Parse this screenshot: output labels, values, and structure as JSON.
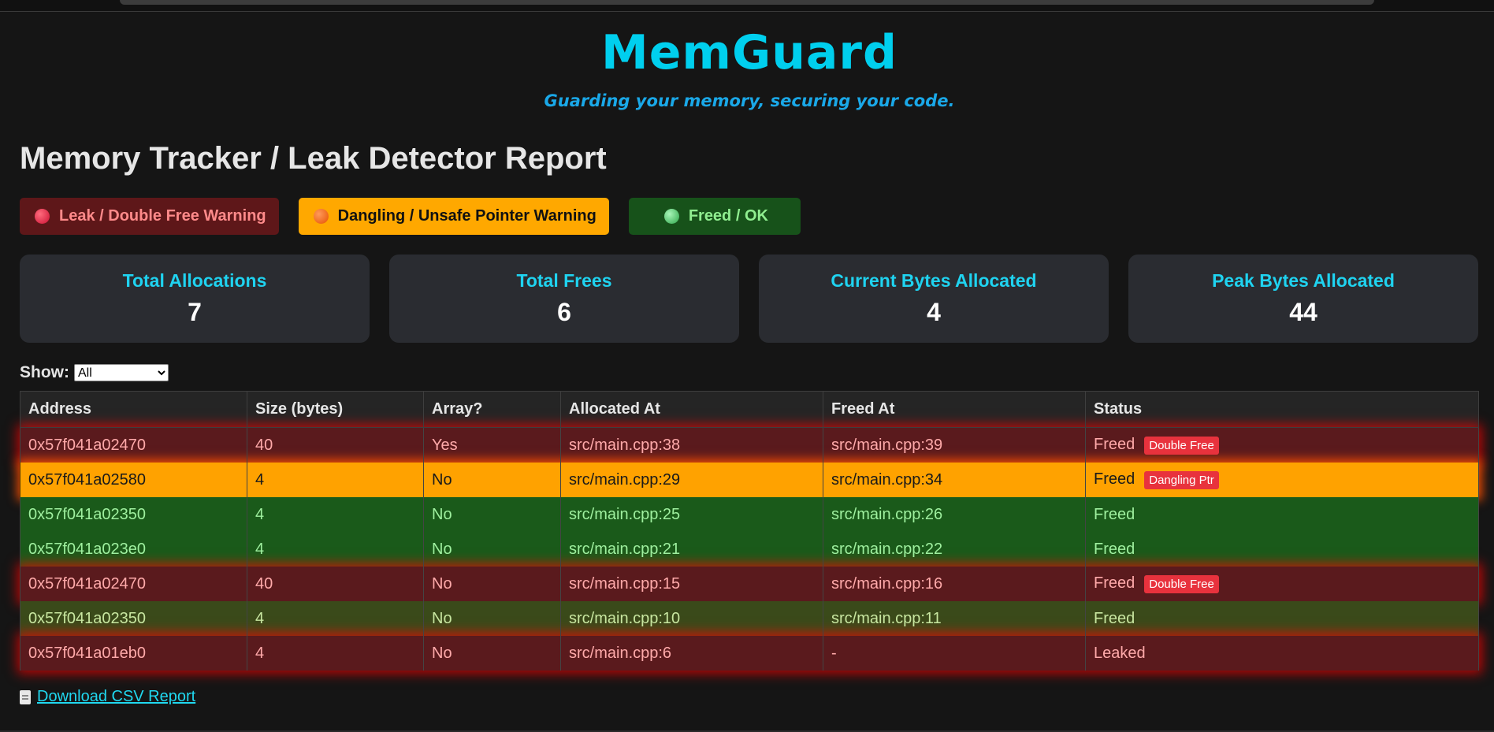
{
  "brand": {
    "name": "MemGuard",
    "tagline": "Guarding your memory, securing your code."
  },
  "report_title": "Memory Tracker / Leak Detector Report",
  "legend": [
    {
      "label": "Leak / Double Free Warning",
      "color": "#5e1719"
    },
    {
      "label": "Dangling / Unsafe Pointer Warning",
      "color": "#ffa800"
    },
    {
      "label": "Freed / OK",
      "color": "#17521a"
    }
  ],
  "stats": [
    {
      "label": "Total Allocations",
      "value": "7"
    },
    {
      "label": "Total Frees",
      "value": "6"
    },
    {
      "label": "Current Bytes Allocated",
      "value": "4"
    },
    {
      "label": "Peak Bytes Allocated",
      "value": "44"
    }
  ],
  "filter": {
    "label": "Show:",
    "selected": "All"
  },
  "table": {
    "headers": [
      "Address",
      "Size (bytes)",
      "Array?",
      "Allocated At",
      "Freed At",
      "Status"
    ],
    "rows": [
      {
        "address": "0x57f041a02470",
        "size": "40",
        "array": "Yes",
        "allocated_at": "src/main.cpp:38",
        "freed_at": "src/main.cpp:39",
        "status": "Freed",
        "badge": "Double Free"
      },
      {
        "address": "0x57f041a02580",
        "size": "4",
        "array": "No",
        "allocated_at": "src/main.cpp:29",
        "freed_at": "src/main.cpp:34",
        "status": "Freed",
        "badge": "Dangling Ptr"
      },
      {
        "address": "0x57f041a02350",
        "size": "4",
        "array": "No",
        "allocated_at": "src/main.cpp:25",
        "freed_at": "src/main.cpp:26",
        "status": "Freed",
        "badge": ""
      },
      {
        "address": "0x57f041a023e0",
        "size": "4",
        "array": "No",
        "allocated_at": "src/main.cpp:21",
        "freed_at": "src/main.cpp:22",
        "status": "Freed",
        "badge": ""
      },
      {
        "address": "0x57f041a02470",
        "size": "40",
        "array": "No",
        "allocated_at": "src/main.cpp:15",
        "freed_at": "src/main.cpp:16",
        "status": "Freed",
        "badge": "Double Free"
      },
      {
        "address": "0x57f041a02350",
        "size": "4",
        "array": "No",
        "allocated_at": "src/main.cpp:10",
        "freed_at": "src/main.cpp:11",
        "status": "Freed",
        "badge": ""
      },
      {
        "address": "0x57f041a01eb0",
        "size": "4",
        "array": "No",
        "allocated_at": "src/main.cpp:6",
        "freed_at": "-",
        "status": "Leaked",
        "badge": ""
      }
    ]
  },
  "download": {
    "label": "Download CSV Report",
    "icon": "document-icon"
  }
}
